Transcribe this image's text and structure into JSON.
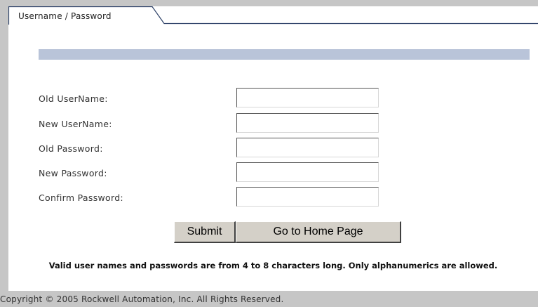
{
  "tab": {
    "label": "Username / Password"
  },
  "form": {
    "fields": [
      {
        "label": "Old UserName:",
        "value": ""
      },
      {
        "label": "New UserName:",
        "value": ""
      },
      {
        "label": "Old Password:",
        "value": ""
      },
      {
        "label": "New Password:",
        "value": ""
      },
      {
        "label": "Confirm Password:",
        "value": ""
      }
    ]
  },
  "buttons": {
    "submit": "Submit",
    "home": "Go to Home Page"
  },
  "note": "Valid user names and passwords are from 4 to 8 characters long. Only alphanumerics are allowed.",
  "footer": "Copyright © 2005 Rockwell Automation, Inc. All Rights Reserved.",
  "colors": {
    "header_bar": "#b9c4d9",
    "tab_line": "#2b3f66",
    "background": "#c6c6c6"
  }
}
